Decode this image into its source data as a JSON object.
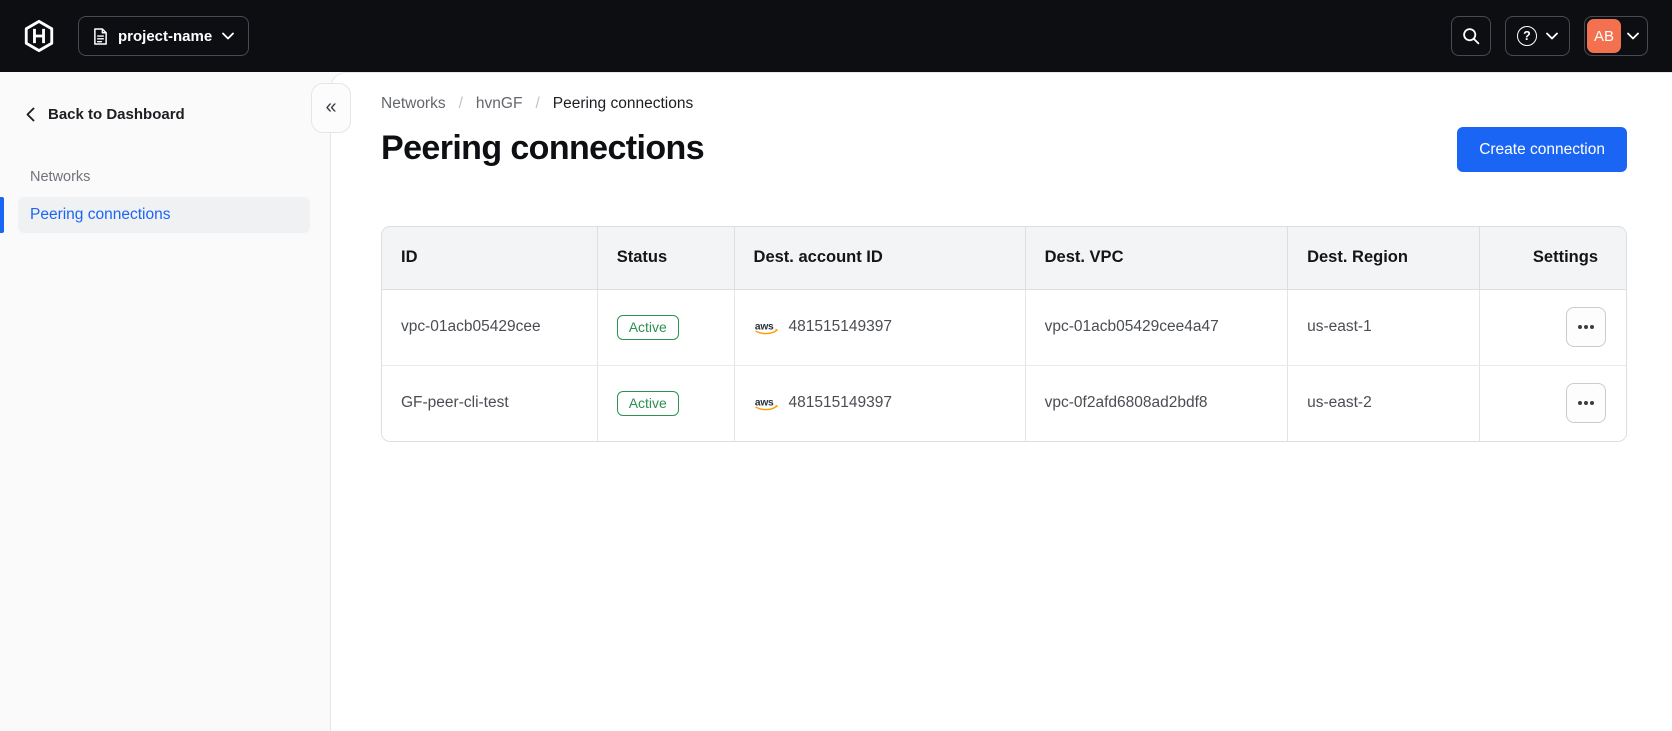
{
  "topbar": {
    "project_name": "project-name",
    "avatar_initials": "AB"
  },
  "icons": {
    "help_glyph": "?",
    "collapse_glyph": "«"
  },
  "sidebar": {
    "back_label": "Back to Dashboard",
    "section_label": "Networks",
    "items": [
      {
        "label": "Peering connections",
        "active": true
      }
    ]
  },
  "breadcrumb": {
    "items": [
      "Networks",
      "hvnGF",
      "Peering connections"
    ]
  },
  "page": {
    "title": "Peering connections",
    "create_button_label": "Create connection"
  },
  "table": {
    "columns": [
      "ID",
      "Status",
      "Dest. account ID",
      "Dest. VPC",
      "Dest. Region",
      "Settings"
    ],
    "rows": [
      {
        "id": "vpc-01acb05429cee",
        "status": "Active",
        "dest_account_id": "481515149397",
        "dest_vpc": "vpc-01acb05429cee4a47",
        "dest_region": "us-east-1"
      },
      {
        "id": "GF-peer-cli-test",
        "status": "Active",
        "dest_account_id": "481515149397",
        "dest_vpc": "vpc-0f2afd6808ad2bdf8",
        "dest_region": "us-east-2"
      }
    ]
  },
  "colors": {
    "topbar_bg": "#0d0e12",
    "accent": "#1b65f5",
    "success": "#2c9151",
    "avatar_bg": "#f4714f",
    "aws_orange": "#ff9900"
  }
}
